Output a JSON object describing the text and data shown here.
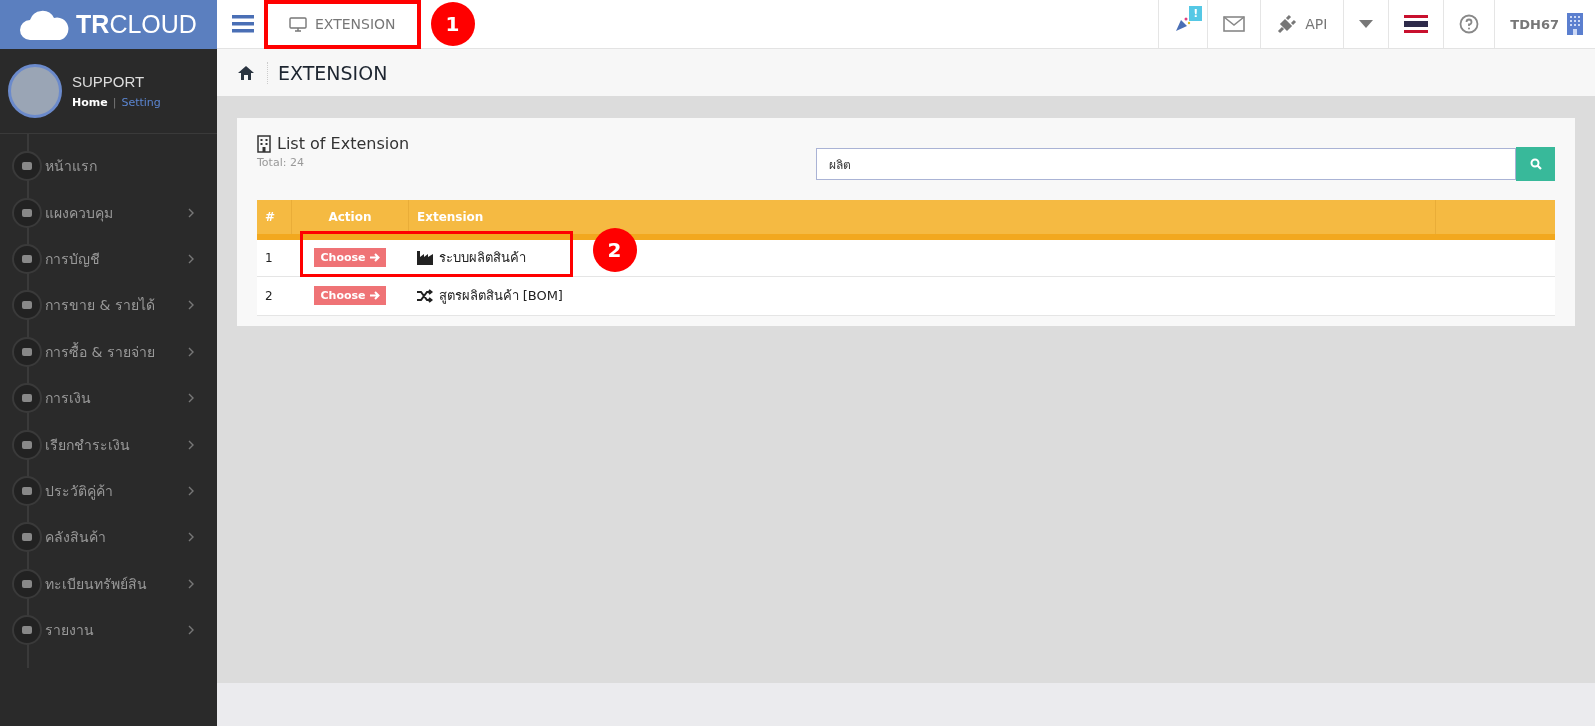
{
  "brand": {
    "logo_bold": "TR",
    "logo_rest": "CLOUD"
  },
  "top_tab": {
    "label": "EXTENSION",
    "highlighted": true,
    "callout": "1"
  },
  "top_right": {
    "notification_badge": "!",
    "api": "API",
    "user": "TDH67"
  },
  "profile": {
    "name": "SUPPORT",
    "separator": "|",
    "links": [
      {
        "label": "Home",
        "selected": true
      },
      {
        "label": "Setting",
        "selected": false
      }
    ]
  },
  "sidebar": {
    "items": [
      {
        "label": "หน้าแรก",
        "expandable": false
      },
      {
        "label": "แผงควบคุม",
        "expandable": true
      },
      {
        "label": "การบัญชี",
        "expandable": true
      },
      {
        "label": "การขาย & รายได้",
        "expandable": true
      },
      {
        "label": "การซื้อ & รายจ่าย",
        "expandable": true
      },
      {
        "label": "การเงิน",
        "expandable": true
      },
      {
        "label": "เรียกชำระเงิน",
        "expandable": true
      },
      {
        "label": "ประวัติคู่ค้า",
        "expandable": true
      },
      {
        "label": "คลังสินค้า",
        "expandable": true
      },
      {
        "label": "ทะเบียนทรัพย์สิน",
        "expandable": true
      },
      {
        "label": "รายงาน",
        "expandable": true
      }
    ]
  },
  "breadcrumb": {
    "title": "EXTENSION"
  },
  "panel": {
    "title": "List of Extension",
    "total_label": "Total:",
    "total": "24",
    "search": {
      "value": "ผลิต"
    }
  },
  "table": {
    "columns": [
      "#",
      "Action",
      "Extension"
    ],
    "rows": [
      {
        "num": "1",
        "button": "Choose",
        "kind": "factory",
        "name": "ระบบผลิตสินค้า",
        "highlighted": true,
        "callout": "2"
      },
      {
        "num": "2",
        "button": "Choose",
        "kind": "shuffle",
        "name": "สูตรผลิตสินค้า [BOM]",
        "highlighted": false
      }
    ]
  }
}
